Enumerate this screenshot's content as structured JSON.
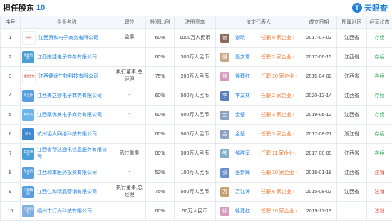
{
  "section": {
    "title": "担任股东",
    "count": "10",
    "logo_text": "天眼查",
    "logo_mark": "T"
  },
  "columns": [
    "序号",
    "企业名称",
    "职位",
    "投资比例",
    "注册资本",
    "法定代表人",
    "成立日期",
    "所属地区",
    "经营状态"
  ],
  "rows": [
    {
      "no": "1",
      "logo": "@@",
      "logo_style": "white",
      "company": "江西第和电子商务有限公司",
      "position": "监事",
      "position2": "",
      "ratio": "60%",
      "capital": "1000万人民币",
      "rep": "谢晓",
      "rep_avatar": "谢",
      "avatar_color": "#8b6a5c",
      "tag": "任职 9 家企业",
      "date": "2017-07-03",
      "region": "江西省",
      "status": "存续"
    },
    {
      "no": "2",
      "logo": "嫩捷电商",
      "logo_style": "#4a9fd6",
      "company": "江西嫩捷电子商务有限公司",
      "position": "-",
      "position2": "",
      "ratio": "60%",
      "capital": "300万人民币",
      "rep": "聂文君",
      "rep_avatar": "聂",
      "avatar_color": "#c8a88a",
      "tag": "任职 2 家企业",
      "date": "2017-06-15",
      "region": "江西省",
      "status": "存续"
    },
    {
      "no": "3",
      "logo": "健途生物",
      "logo_style": "white",
      "company": "江西健途生物科技有限公司",
      "position": "执行董事,总",
      "position2": "经理",
      "ratio": "75%",
      "capital": "200万人民币",
      "rep": "徐建红",
      "rep_avatar": "徐",
      "avatar_color": "#d79bc0",
      "tag": "任职 10 家企业",
      "date": "2015-04-02",
      "region": "江西省",
      "status": "存续"
    },
    {
      "no": "4",
      "logo": "美之妙",
      "logo_style": "#5aa0e0",
      "company": "江西美之妙电子商务有限公司",
      "position": "-",
      "position2": "",
      "ratio": "60%",
      "capital": "500万人民币",
      "rep": "李友林",
      "rep_avatar": "李",
      "avatar_color": "#5b7fb8",
      "tag": "任职 2 家企业",
      "date": "2020-12-14",
      "region": "江西省",
      "status": "存续"
    },
    {
      "no": "5",
      "logo": "聚优美",
      "logo_style": "#6cb5e8",
      "company": "江西聚优美电子商务有限公司",
      "position": "-",
      "position2": "",
      "ratio": "60%",
      "capital": "500万人民币",
      "rep": "金璧",
      "rep_avatar": "金",
      "avatar_color": "#8ca0c0",
      "tag": "任职 3 家企业",
      "date": "2019-06-12",
      "region": "江西省",
      "status": "存续"
    },
    {
      "no": "6",
      "logo": "坦大",
      "logo_style": "#3f89d0",
      "company": "杭州坦大网络科技有限公司",
      "position": "-",
      "position2": "",
      "ratio": "60%",
      "capital": "500万人民币",
      "rep": "金璧",
      "rep_avatar": "金",
      "avatar_color": "#8ca0c0",
      "tag": "任职 3 家企业",
      "date": "2017-08-21",
      "region": "浙江省",
      "status": "存续"
    },
    {
      "no": "7",
      "logo": "帮达通讯",
      "logo_style": "#4a9fd6",
      "company": "江西省帮达通讯信息服务有限公司",
      "position": "执行董事",
      "position2": "",
      "ratio": "80%",
      "capital": "300万人民币",
      "rep": "邹胜军",
      "rep_avatar": "邹",
      "avatar_color": "#7fb0c8",
      "tag": "任职 11 家企业",
      "date": "2017-08-09",
      "region": "江西省",
      "status": "存续"
    },
    {
      "no": "8",
      "logo": "和本药业",
      "logo_style": "#5aa0e0",
      "company": "江西和本医药投资有限公司",
      "position": "-",
      "position2": "",
      "ratio": "52%",
      "capital": "100万人民币",
      "rep": "张新辉",
      "rep_avatar": "张",
      "avatar_color": "#6a8fc8",
      "tag": "任职 10 家企业",
      "date": "2018-01-18",
      "region": "江西省",
      "status": "注销"
    },
    {
      "no": "9",
      "logo": "仁和精品",
      "logo_style": "#5aa0e0",
      "company": "江西仁和精品营销有限公司",
      "position": "执行董事,总",
      "position2": "经理",
      "ratio": "75%",
      "capital": "500万人民币",
      "rep": "万江涛",
      "rep_avatar": "万",
      "avatar_color": "#c8a070",
      "tag": "任职 6 家企业",
      "date": "2015-08-03",
      "region": "江西省",
      "status": "注销"
    },
    {
      "no": "10",
      "logo": "灯尚科技",
      "logo_style": "#7fb0e0",
      "company": "福州市灯尚科技有限公司",
      "position": "-",
      "position2": "",
      "ratio": "60%",
      "capital": "50万人民币",
      "rep": "徐建红",
      "rep_avatar": "徐",
      "avatar_color": "#d79bc0",
      "tag": "任职 10 家企业",
      "date": "2015-11-13",
      "region": "",
      "status": "注销"
    }
  ],
  "colors": {
    "accent": "#1f80e0",
    "tag": "#f06b1c",
    "active": "#25a55a",
    "cancelled": "#e6493f"
  },
  "icons": {
    "header_logo": "tianyancha-logo-icon",
    "tag_arrow": "chevron-right-icon"
  }
}
